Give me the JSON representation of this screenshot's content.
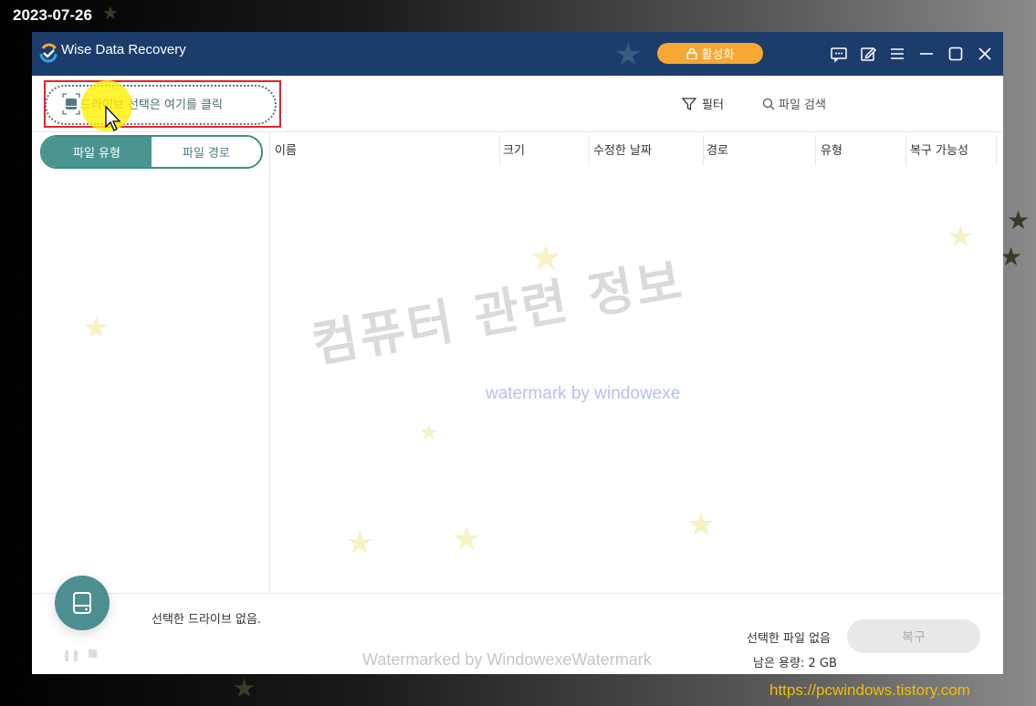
{
  "screenshot": {
    "date_stamp": "2023-07-26",
    "site_url": "https://pcwindows.tistory.com"
  },
  "titlebar": {
    "app_title": "Wise Data Recovery",
    "activate_label": "활성화",
    "icons": [
      "feedback-icon",
      "edit-icon",
      "menu-icon",
      "minimize-icon",
      "maximize-icon",
      "close-icon"
    ]
  },
  "toolbar": {
    "drive_select_label": "드라이브 선택은 여기를 클릭",
    "filter_label": "필터",
    "search_label": "파일 검색"
  },
  "tabs": {
    "file_type": "파일 유형",
    "file_path": "파일 경로"
  },
  "table": {
    "columns": [
      "이름",
      "크기",
      "수정한 날짜",
      "경로",
      "유형",
      "복구 가능성"
    ]
  },
  "watermarks": {
    "main": "컴퓨터 관련 정보",
    "sub": "watermark by windowexe",
    "bottom": "Watermarked by WindowexeWatermark"
  },
  "footer": {
    "no_drive": "선택한 드라이브 없음.",
    "no_file": "선택한 파일 없음",
    "free_space": "남은 용량: 2 GB",
    "recover_label": "복구"
  },
  "colors": {
    "titlebar": "#1c3d6b",
    "accent": "#4a9490",
    "activate": "#f6a832",
    "highlight": "#e0242b"
  }
}
